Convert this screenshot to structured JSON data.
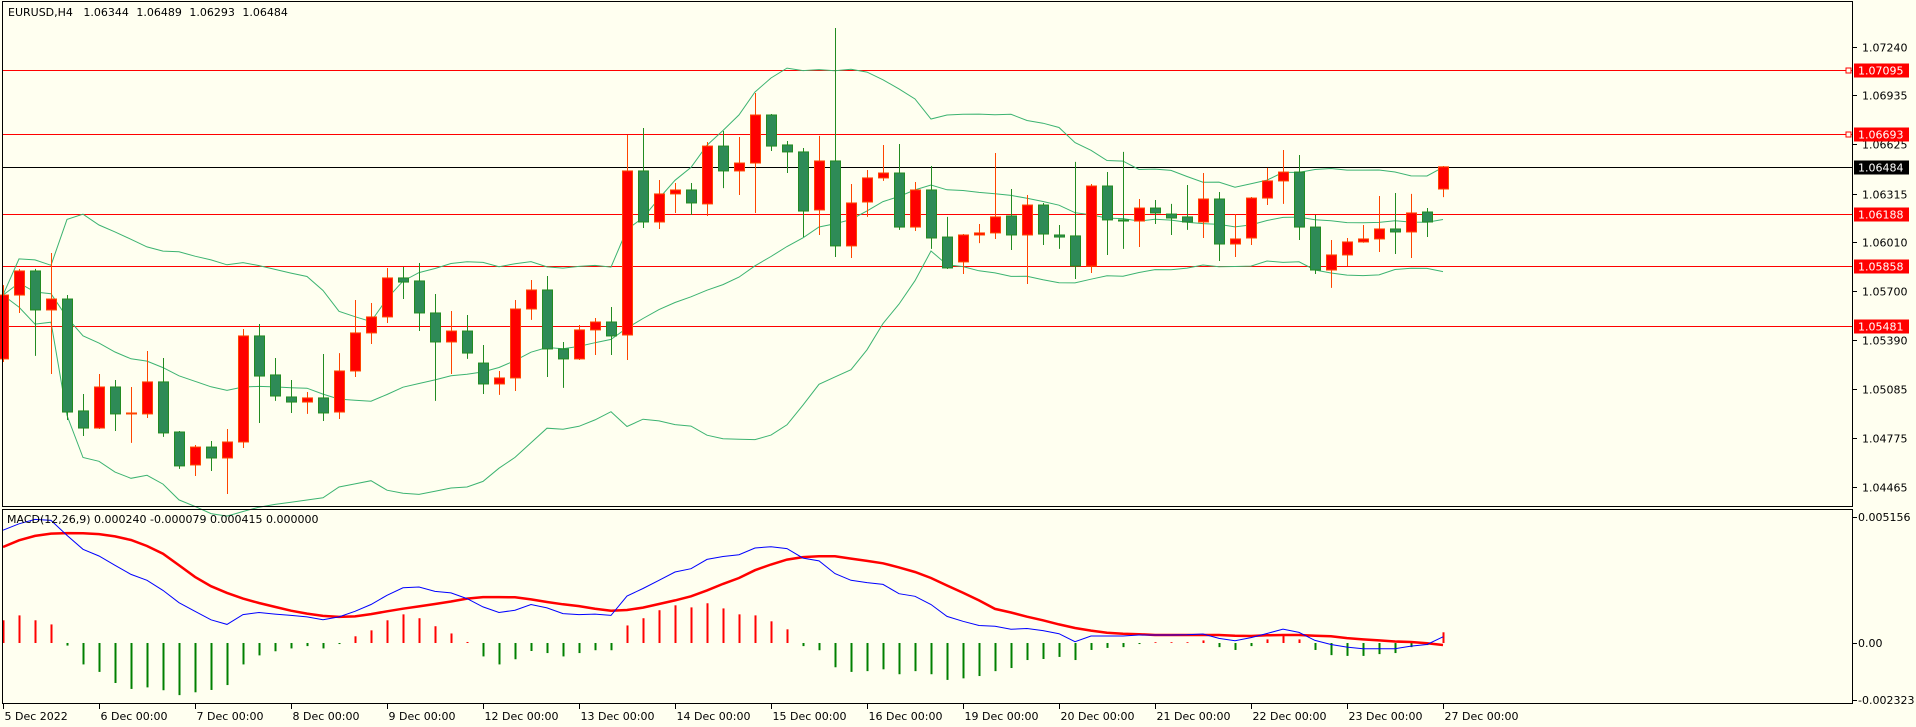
{
  "chart_data": {
    "type": "candlestick",
    "symbol_header": "EURUSD,H4",
    "header_ohlc": [
      "1.06344",
      "1.06489",
      "1.06293",
      "1.06484"
    ],
    "colors": {
      "background": "#FFFFF0",
      "bull_body": "#FF0000",
      "bull_edge": "#FF4500",
      "bear_body": "#2E8B57",
      "bear_edge": "#228B22",
      "bands": "#3CB371",
      "level": "#FF0000",
      "bid": "#000000",
      "macd_main": "#0000FF",
      "macd_signal": "#FF0000",
      "hist_pos": "#FF0000",
      "hist_neg": "#008000"
    },
    "price_axis": {
      "range": [
        1.0437,
        1.0752
      ],
      "ticks": [
        "1.07240",
        "1.06935",
        "1.06625",
        "1.06315",
        "1.06010",
        "1.05700",
        "1.05390",
        "1.05085",
        "1.04775",
        "1.04465"
      ]
    },
    "levels": [
      {
        "price": 1.07095,
        "label": "1.07095",
        "marker": true
      },
      {
        "price": 1.06693,
        "label": "1.06693",
        "marker": true
      },
      {
        "price": 1.06188,
        "label": "1.06188",
        "marker": false
      },
      {
        "price": 1.05858,
        "label": "1.05858",
        "marker": false
      },
      {
        "price": 1.05481,
        "label": "1.05481",
        "marker": false
      }
    ],
    "bid": {
      "price": 1.06484,
      "label": "1.06484"
    },
    "x_labels": [
      {
        "index": 0,
        "label": "5 Dec 2022"
      },
      {
        "index": 6,
        "label": "6 Dec 00:00"
      },
      {
        "index": 12,
        "label": "7 Dec 00:00"
      },
      {
        "index": 18,
        "label": "8 Dec 00:00"
      },
      {
        "index": 24,
        "label": "9 Dec 00:00"
      },
      {
        "index": 30,
        "label": "12 Dec 00:00"
      },
      {
        "index": 36,
        "label": "13 Dec 00:00"
      },
      {
        "index": 42,
        "label": "14 Dec 00:00"
      },
      {
        "index": 48,
        "label": "15 Dec 00:00"
      },
      {
        "index": 54,
        "label": "16 Dec 00:00"
      },
      {
        "index": 60,
        "label": "19 Dec 00:00"
      },
      {
        "index": 66,
        "label": "20 Dec 00:00"
      },
      {
        "index": 72,
        "label": "21 Dec 00:00"
      },
      {
        "index": 78,
        "label": "22 Dec 00:00"
      },
      {
        "index": 84,
        "label": "23 Dec 00:00"
      },
      {
        "index": 90,
        "label": "27 Dec 00:00"
      }
    ],
    "bollinger": {
      "period": 20,
      "deviations": 2
    },
    "candles_ohlc": [
      [
        1.05272,
        1.05738,
        1.05253,
        1.05675
      ],
      [
        1.05675,
        1.05839,
        1.05562,
        1.05827
      ],
      [
        1.05827,
        1.0584,
        1.05291,
        1.05581
      ],
      [
        1.05581,
        1.0594,
        1.05177,
        1.0565
      ],
      [
        1.0565,
        1.05675,
        1.04887,
        1.04937
      ],
      [
        1.04944,
        1.05051,
        1.04786,
        1.04836
      ],
      [
        1.04836,
        1.05177,
        1.0483,
        1.05095
      ],
      [
        1.05095,
        1.05139,
        1.04817,
        1.04925
      ],
      [
        1.04931,
        1.05095,
        1.04742,
        1.04931
      ],
      [
        1.04925,
        1.05322,
        1.04899,
        1.05127
      ],
      [
        1.05127,
        1.05278,
        1.0478,
        1.04805
      ],
      [
        1.04811,
        1.04817,
        1.04578,
        1.04597
      ],
      [
        1.04603,
        1.04729,
        1.04533,
        1.04716
      ],
      [
        1.04716,
        1.04754,
        1.04565,
        1.04647
      ],
      [
        1.04647,
        1.0483,
        1.0442,
        1.04748
      ],
      [
        1.04748,
        1.05461,
        1.0471,
        1.05417
      ],
      [
        1.05417,
        1.05492,
        1.04868,
        1.05164
      ],
      [
        1.05171,
        1.05278,
        1.05007,
        1.05038
      ],
      [
        1.05032,
        1.05139,
        1.04931,
        1.05
      ],
      [
        1.05,
        1.05063,
        1.04925,
        1.05026
      ],
      [
        1.05026,
        1.05303,
        1.0488,
        1.04931
      ],
      [
        1.04937,
        1.05309,
        1.04893,
        1.05196
      ],
      [
        1.05196,
        1.05644,
        1.05158,
        1.05436
      ],
      [
        1.05436,
        1.05625,
        1.05366,
        1.05537
      ],
      [
        1.05537,
        1.05846,
        1.05499,
        1.05783
      ],
      [
        1.05783,
        1.05852,
        1.0565,
        1.05757
      ],
      [
        1.05764,
        1.05877,
        1.05448,
        1.05562
      ],
      [
        1.05562,
        1.05682,
        1.05007,
        1.05379
      ],
      [
        1.05379,
        1.05574,
        1.05177,
        1.05448
      ],
      [
        1.05448,
        1.05549,
        1.05272,
        1.05309
      ],
      [
        1.05246,
        1.0536,
        1.05051,
        1.05114
      ],
      [
        1.05114,
        1.05196,
        1.05045,
        1.05152
      ],
      [
        1.05152,
        1.05644,
        1.0507,
        1.05587
      ],
      [
        1.05587,
        1.0577,
        1.05518,
        1.05707
      ],
      [
        1.05707,
        1.05795,
        1.05158,
        1.05335
      ],
      [
        1.05335,
        1.05379,
        1.05089,
        1.05272
      ],
      [
        1.05272,
        1.05486,
        1.05265,
        1.05455
      ],
      [
        1.05455,
        1.0553,
        1.05297,
        1.05505
      ],
      [
        1.05505,
        1.056,
        1.05297,
        1.05417
      ],
      [
        1.05423,
        1.06685,
        1.05265,
        1.06458
      ],
      [
        1.06458,
        1.06729,
        1.06098,
        1.06136
      ],
      [
        1.06136,
        1.06401,
        1.06092,
        1.06313
      ],
      [
        1.06313,
        1.06382,
        1.06193,
        1.06338
      ],
      [
        1.06338,
        1.06382,
        1.0618,
        1.06256
      ],
      [
        1.0625,
        1.06641,
        1.06174,
        1.06615
      ],
      [
        1.06615,
        1.0671,
        1.0635,
        1.06458
      ],
      [
        1.06458,
        1.06672,
        1.06306,
        1.06508
      ],
      [
        1.06508,
        1.0695,
        1.06193,
        1.06811
      ],
      [
        1.06811,
        1.06817,
        1.06584,
        1.06615
      ],
      [
        1.06622,
        1.06647,
        1.06445,
        1.06578
      ],
      [
        1.06578,
        1.06603,
        1.06041,
        1.06205
      ],
      [
        1.06212,
        1.06679,
        1.06054,
        1.06521
      ],
      [
        1.06521,
        1.0736,
        1.05915,
        1.05985
      ],
      [
        1.05985,
        1.06376,
        1.05909,
        1.06256
      ],
      [
        1.06262,
        1.06464,
        1.06168,
        1.06414
      ],
      [
        1.06414,
        1.06622,
        1.06395,
        1.06445
      ],
      [
        1.06445,
        1.06628,
        1.06086,
        1.06104
      ],
      [
        1.06104,
        1.06388,
        1.06079,
        1.06338
      ],
      [
        1.06338,
        1.06489,
        1.05966,
        1.06035
      ],
      [
        1.06041,
        1.06168,
        1.05839,
        1.05846
      ],
      [
        1.05884,
        1.0606,
        1.05808,
        1.06054
      ],
      [
        1.06054,
        1.06123,
        1.06003,
        1.06067
      ],
      [
        1.06067,
        1.06571,
        1.06029,
        1.06168
      ],
      [
        1.06174,
        1.06344,
        1.05959,
        1.06054
      ],
      [
        1.06054,
        1.06306,
        1.05745,
        1.06243
      ],
      [
        1.06243,
        1.06256,
        1.05991,
        1.0606
      ],
      [
        1.06054,
        1.06117,
        1.05966,
        1.06041
      ],
      [
        1.06048,
        1.06515,
        1.05776,
        1.05858
      ],
      [
        1.05858,
        1.06376,
        1.05814,
        1.06363
      ],
      [
        1.06363,
        1.06451,
        1.05928,
        1.06149
      ],
      [
        1.06149,
        1.06578,
        1.05966,
        1.06142
      ],
      [
        1.06142,
        1.06281,
        1.05978,
        1.06224
      ],
      [
        1.06224,
        1.06275,
        1.06123,
        1.06193
      ],
      [
        1.06186,
        1.0625,
        1.06054,
        1.06161
      ],
      [
        1.06168,
        1.06369,
        1.06086,
        1.06136
      ],
      [
        1.06136,
        1.06445,
        1.06035,
        1.06281
      ],
      [
        1.06281,
        1.06325,
        1.0589,
        1.05997
      ],
      [
        1.05997,
        1.06186,
        1.05915,
        1.06029
      ],
      [
        1.06035,
        1.06294,
        1.05991,
        1.06287
      ],
      [
        1.06287,
        1.06477,
        1.06243,
        1.06395
      ],
      [
        1.06395,
        1.0659,
        1.0625,
        1.06451
      ],
      [
        1.06451,
        1.06559,
        1.06022,
        1.06104
      ],
      [
        1.06104,
        1.0618,
        1.05808,
        1.05833
      ],
      [
        1.05833,
        1.06022,
        1.0572,
        1.05928
      ],
      [
        1.05928,
        1.06035,
        1.05858,
        1.0601
      ],
      [
        1.0601,
        1.06117,
        1.06005,
        1.06029
      ],
      [
        1.06029,
        1.063,
        1.05947,
        1.06092
      ],
      [
        1.06092,
        1.06319,
        1.05934,
        1.06073
      ],
      [
        1.06073,
        1.06313,
        1.05909,
        1.06193
      ],
      [
        1.06199,
        1.06224,
        1.06041,
        1.06136
      ],
      [
        1.06344,
        1.06489,
        1.06293,
        1.06484
      ]
    ],
    "macd": {
      "label": "MACD(12,26,9) 0.000240 -0.000079 0.000415 0.000000",
      "range": [
        -0.002323,
        0.005156
      ],
      "ticks": [
        "0.005156",
        "0.00",
        "-0.002323"
      ],
      "main": [
        0.00437,
        0.00462,
        0.00479,
        0.00475,
        0.00417,
        0.00363,
        0.00337,
        0.00301,
        0.00266,
        0.00243,
        0.00204,
        0.00156,
        0.00123,
        0.0009,
        0.00072,
        0.0011,
        0.00118,
        0.00112,
        0.00107,
        0.00101,
        0.0009,
        0.00101,
        0.00123,
        0.00149,
        0.00185,
        0.00214,
        0.00217,
        0.002,
        0.00194,
        0.00172,
        0.0014,
        0.00118,
        0.00127,
        0.00149,
        0.00136,
        0.00114,
        0.0011,
        0.00112,
        0.00107,
        0.00182,
        0.00211,
        0.00243,
        0.00275,
        0.00288,
        0.00324,
        0.00335,
        0.00342,
        0.00368,
        0.00373,
        0.00366,
        0.00329,
        0.00318,
        0.00269,
        0.00243,
        0.00234,
        0.00227,
        0.00191,
        0.00181,
        0.00149,
        0.00103,
        0.00084,
        0.00068,
        0.00065,
        0.00053,
        0.00056,
        0.00048,
        0.00036,
        5e-05,
        0.00027,
        0.00027,
        0.00027,
        0.00031,
        0.00031,
        0.00031,
        0.00032,
        0.00035,
        0.00018,
        9e-05,
        0.00021,
        0.00037,
        0.00054,
        0.00041,
        0.0001,
        -6e-05,
        -0.00016,
        -0.00022,
        -0.00022,
        -0.00022,
        -0.00012,
        -6e-05,
        0.00024
      ],
      "signal": [
        0.00372,
        0.00398,
        0.00415,
        0.00424,
        0.00426,
        0.00425,
        0.00422,
        0.00413,
        0.00399,
        0.00376,
        0.00346,
        0.00301,
        0.00256,
        0.0022,
        0.00194,
        0.00172,
        0.00155,
        0.0014,
        0.00125,
        0.00114,
        0.00105,
        0.00101,
        0.00103,
        0.00112,
        0.00123,
        0.00133,
        0.00142,
        0.00151,
        0.00161,
        0.00172,
        0.00178,
        0.00178,
        0.00177,
        0.00169,
        0.00159,
        0.0015,
        0.00143,
        0.00133,
        0.00125,
        0.00128,
        0.00137,
        0.00151,
        0.00165,
        0.00181,
        0.00204,
        0.00229,
        0.00252,
        0.00282,
        0.00304,
        0.00323,
        0.00333,
        0.00336,
        0.00336,
        0.00327,
        0.00318,
        0.00309,
        0.00293,
        0.00275,
        0.00252,
        0.00223,
        0.00195,
        0.00165,
        0.00132,
        0.00118,
        0.00102,
        0.00088,
        0.00072,
        0.00058,
        0.00048,
        0.0004,
        0.00036,
        0.00034,
        0.00031,
        0.00031,
        0.00031,
        0.00031,
        0.00031,
        0.00028,
        0.00027,
        0.0003,
        0.00031,
        0.00031,
        0.00028,
        0.00026,
        0.00019,
        0.00014,
        0.0001,
        6e-05,
        4e-05,
        -1e-05,
        -7.9e-05
      ],
      "histogram": [
        0.00088,
        0.00107,
        0.00088,
        0.00072,
        -0.0001,
        -0.00083,
        -0.00112,
        -0.00155,
        -0.00178,
        -0.00172,
        -0.00183,
        -0.00202,
        -0.00191,
        -0.00182,
        -0.00163,
        -0.00083,
        -0.00048,
        -0.00032,
        -0.00021,
        -0.00012,
        -0.00021,
        -4e-05,
        0.00026,
        0.00049,
        0.00088,
        0.00111,
        0.00096,
        0.00065,
        0.00037,
        4e-05,
        -0.00052,
        -0.00083,
        -0.00063,
        -0.00031,
        -0.00039,
        -0.00052,
        -0.00039,
        -0.00028,
        -0.00028,
        0.00068,
        0.00096,
        0.00127,
        0.00146,
        0.00138,
        0.00154,
        0.00134,
        0.00111,
        0.00107,
        0.00084,
        0.00053,
        -0.00012,
        -0.00028,
        -0.00094,
        -0.00112,
        -0.00109,
        -0.00102,
        -0.00121,
        -0.00109,
        -0.00121,
        -0.00143,
        -0.00137,
        -0.00128,
        -0.00109,
        -0.00097,
        -0.00066,
        -0.00062,
        -0.00054,
        -0.00066,
        -0.00027,
        -0.00019,
        -0.00016,
        -4e-05,
        3e-05,
        3e-05,
        3e-05,
        0.0001,
        -0.00016,
        -0.00027,
        -0.00012,
        0.00014,
        0.00027,
        0.00014,
        -0.00027,
        -0.00047,
        -0.0005,
        -0.0005,
        -0.00043,
        -0.00039,
        -0.00016,
        -8e-05,
        0.000415
      ]
    }
  }
}
